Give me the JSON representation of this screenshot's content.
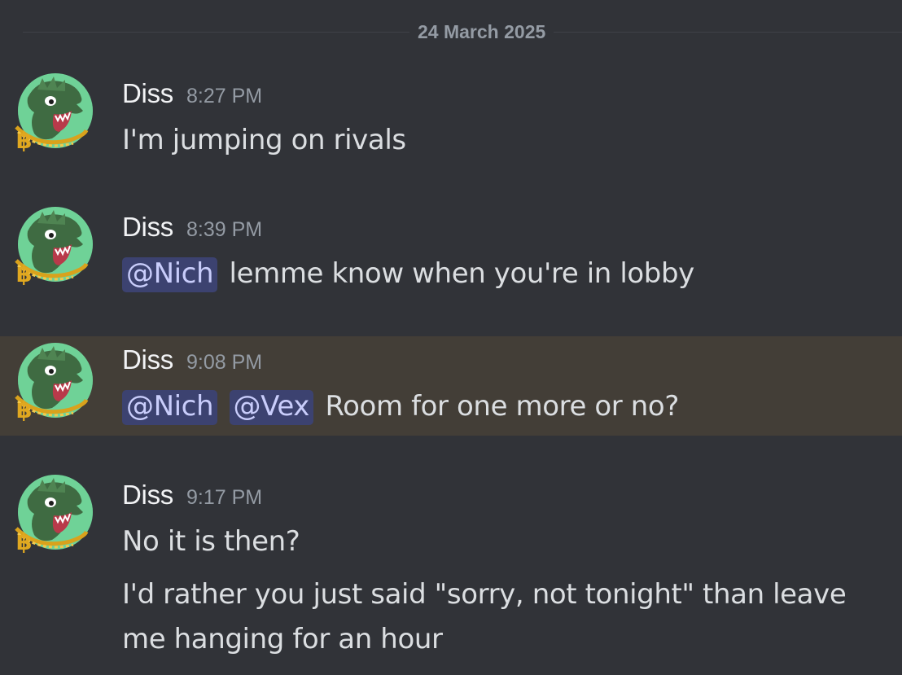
{
  "date_divider": "24 March 2025",
  "messages": [
    {
      "author": "Diss",
      "time": "8:27 PM",
      "lines": [
        {
          "text": "I'm jumping on rivals"
        }
      ]
    },
    {
      "author": "Diss",
      "time": "8:39 PM",
      "mentions": [
        "@Nich"
      ],
      "lines": [
        {
          "text": "lemme know when you're in lobby"
        }
      ]
    },
    {
      "author": "Diss",
      "time": "9:08 PM",
      "highlighted": true,
      "mentions": [
        "@Nich",
        "@Vex"
      ],
      "lines": [
        {
          "text": "Room for one more or no?"
        }
      ]
    },
    {
      "author": "Diss",
      "time": "9:17 PM",
      "lines": [
        {
          "text": "No it is then?"
        },
        {
          "text": "I'd rather you just said \"sorry, not tonight\" than leave"
        },
        {
          "text": "me hanging for an hour"
        }
      ]
    }
  ],
  "colors": {
    "background": "#313338",
    "highlight": "#433e37",
    "mention_bg": "#3c4270",
    "mention_text": "#c9cdfb",
    "username": "#f2f3f5",
    "timestamp": "#949ba4",
    "text": "#dbdee1"
  },
  "icons": {
    "avatar": "green-dragon-with-gold-bitcoin-chain-avatar"
  }
}
